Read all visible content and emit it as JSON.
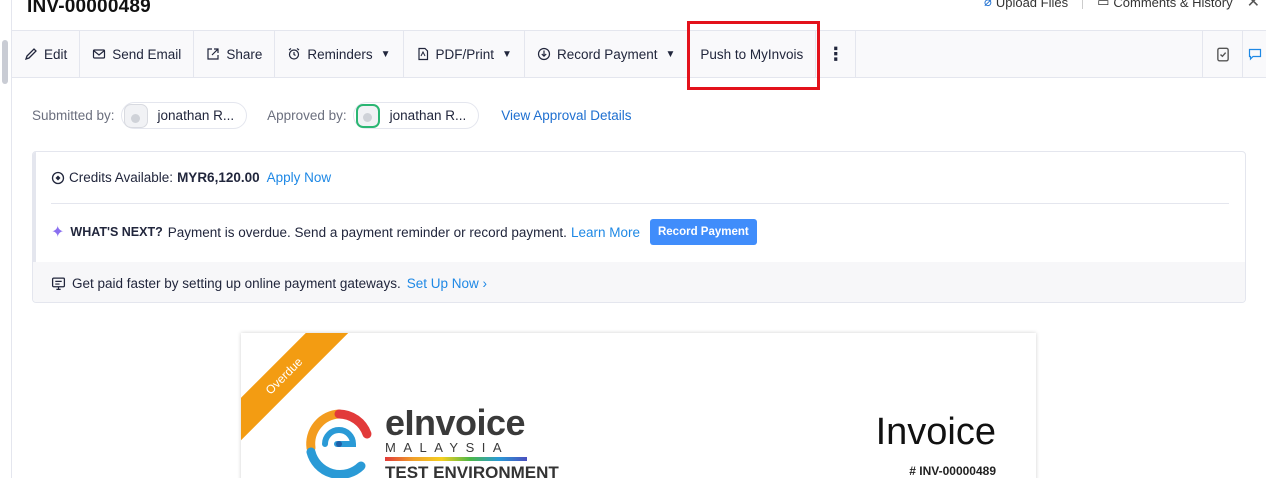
{
  "header": {
    "invoice_number": "INV-00000489",
    "upload_files": "Upload Files",
    "comments_history": "Comments & History"
  },
  "toolbar": {
    "edit": "Edit",
    "send_email": "Send Email",
    "share": "Share",
    "reminders": "Reminders",
    "pdf_print": "PDF/Print",
    "record_payment": "Record Payment",
    "push_to_myinvois": "Push to MyInvois"
  },
  "approval": {
    "submitted_label": "Submitted by:",
    "submitted_name": "jonathan R...",
    "approved_label": "Approved by:",
    "approved_name": "jonathan R...",
    "view_details": "View Approval Details"
  },
  "credits": {
    "label": "Credits Available:",
    "amount": "MYR6,120.00",
    "apply_now": "Apply Now"
  },
  "whats_next": {
    "label": "WHAT'S NEXT?",
    "message": "Payment is overdue. Send a payment reminder or record payment.",
    "learn_more": "Learn More",
    "button": "Record Payment"
  },
  "gateway": {
    "message": "Get paid faster by setting up online payment gateways.",
    "link": "Set Up Now ›"
  },
  "document": {
    "status_ribbon": "Overdue",
    "logo_main": "eInvoice",
    "logo_sub": "MALAYSIA",
    "logo_env": "TEST ENVIRONMENT",
    "title": "Invoice",
    "number": "# INV-00000489"
  },
  "colors": {
    "accent_blue": "#1e88e5",
    "button_blue": "#408dfb",
    "highlight_red": "#e3121b",
    "overdue_orange": "#f39c12"
  }
}
